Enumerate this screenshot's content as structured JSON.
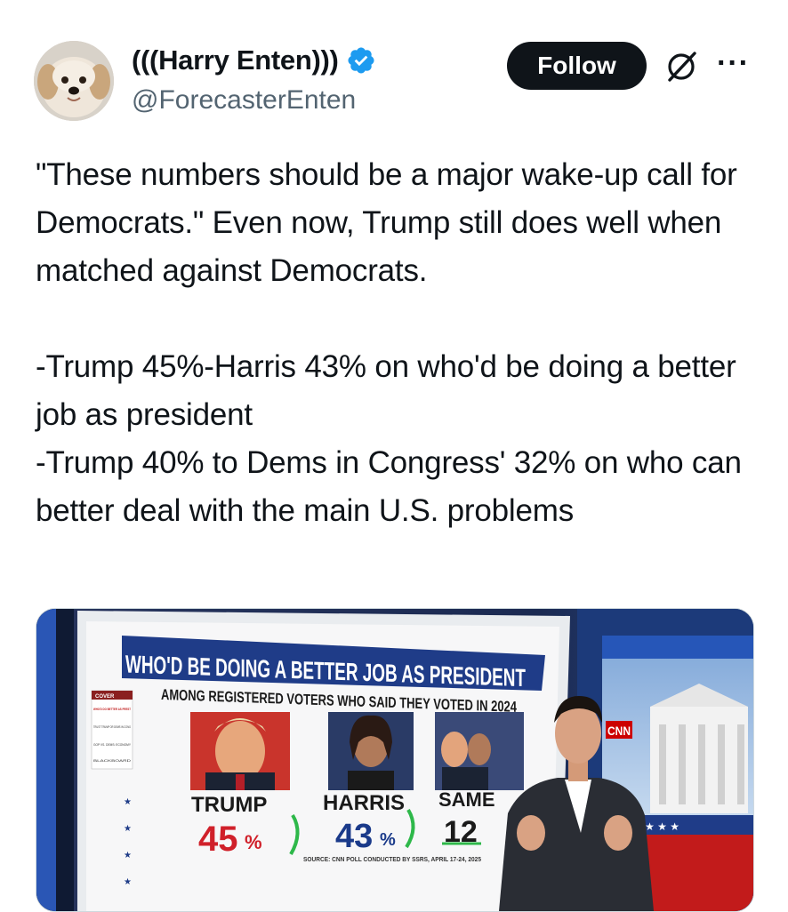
{
  "author": {
    "display_name": "(((Harry Enten)))",
    "handle": "@ForecasterEnten",
    "avatar_icon": "dog-avatar",
    "verified_icon": "verified-badge-icon",
    "verified_color": "#1d9bf0"
  },
  "actions": {
    "follow_label": "Follow",
    "grok_icon": "grok-icon",
    "more_icon": "more-options-icon"
  },
  "tweet": {
    "text": "\"These numbers should be a major wake-up call for Democrats.\" Even now, Trump still does well when matched against Democrats.\n\n-Trump 45%-Harris 43% on who'd be doing a better job as president\n-Trump 40% to Dems in Congress' 32% on who can better deal with the main U.S. problems"
  },
  "media": {
    "headline": "WHO'D BE DOING A BETTER JOB AS PRESIDENT",
    "subhead": "AMONG REGISTERED VOTERS WHO SAID THEY VOTED IN 2024",
    "sidebar_items": [
      "COVER",
      "WHO'D DO BETTER AS PREST",
      "TRUST TRUMP OR DEMS IN CONG",
      "GOP VS. DEMS: ECONOMY",
      "BLACKBOARD"
    ],
    "candidates": [
      {
        "name": "TRUMP",
        "value": "45",
        "unit": "%",
        "color": "#d0202a"
      },
      {
        "name": "HARRIS",
        "value": "43",
        "unit": "%",
        "color": "#1a3a8a"
      },
      {
        "name": "SAME",
        "value": "12",
        "unit": "",
        "color": "#1a1a1a"
      }
    ],
    "source": "SOURCE: CNN POLL CONDUCTED BY SSRS, APRIL 17-24, 2025",
    "network_logo": "CNN",
    "accent_color": "#cc0000"
  }
}
